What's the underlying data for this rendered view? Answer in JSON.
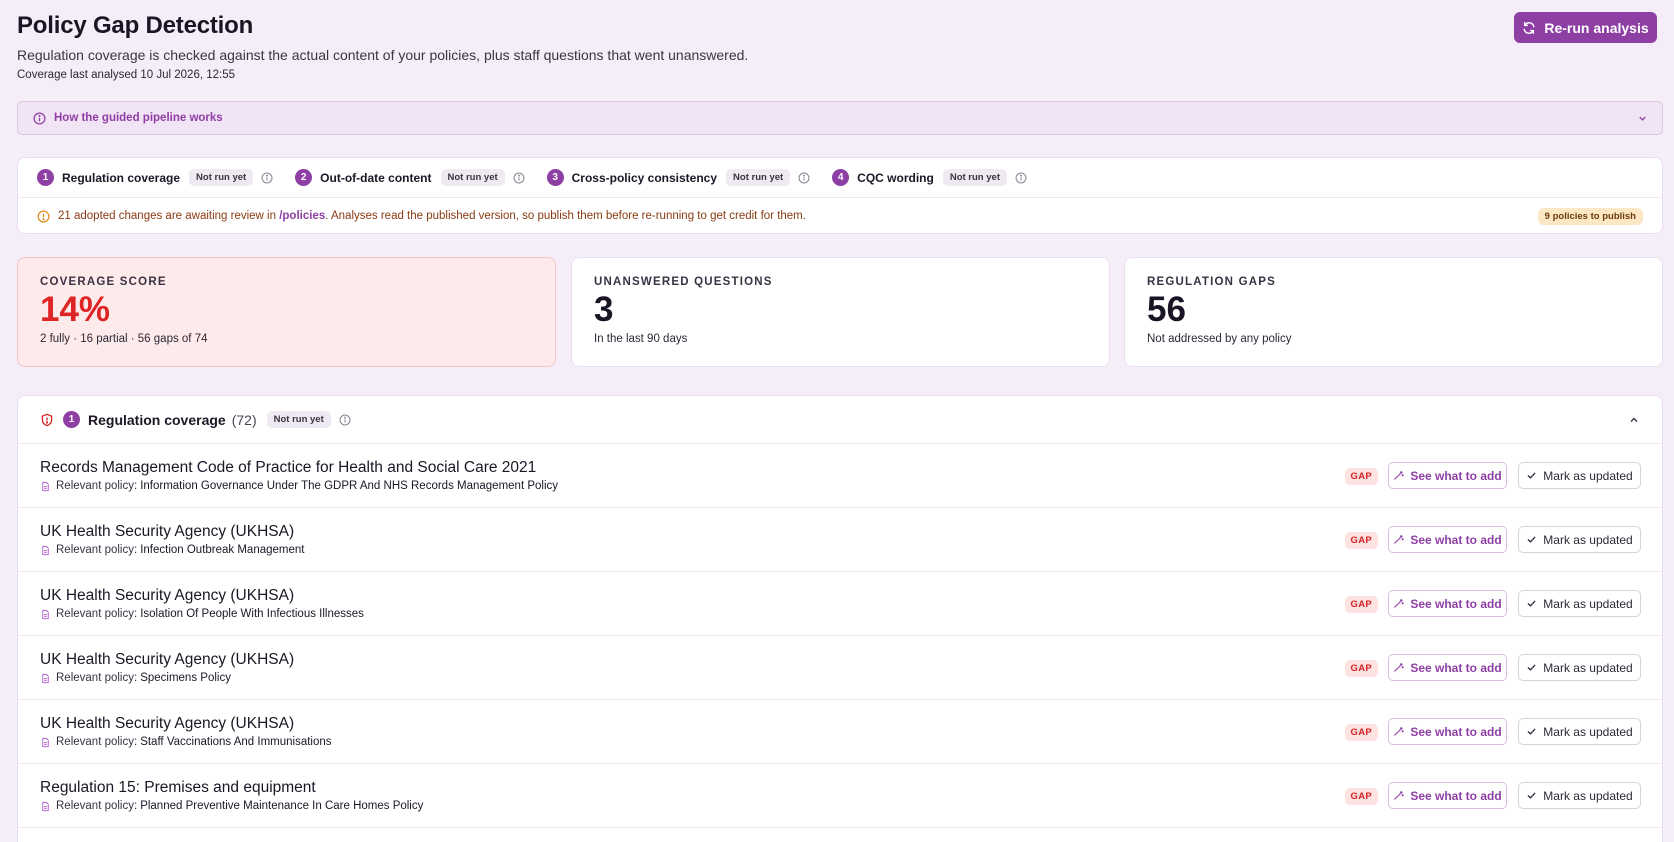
{
  "header": {
    "title": "Policy Gap Detection",
    "subtitle": "Regulation coverage is checked against the actual content of your policies, plus staff questions that went unanswered.",
    "last_analysed": "Coverage last analysed 10 Jul 2026, 12:55",
    "rerun_label": "Re-run analysis"
  },
  "pipeline": {
    "label": "How the guided pipeline works"
  },
  "steps": [
    {
      "num": "1",
      "label": "Regulation coverage",
      "status": "Not run yet"
    },
    {
      "num": "2",
      "label": "Out-of-date content",
      "status": "Not run yet"
    },
    {
      "num": "3",
      "label": "Cross-policy consistency",
      "status": "Not run yet"
    },
    {
      "num": "4",
      "label": "CQC wording",
      "status": "Not run yet"
    }
  ],
  "notice": {
    "text_before": "21 adopted changes are awaiting review in ",
    "link": "/policies",
    "text_after": ". Analyses read the published version, so publish them before re-running to get credit for them.",
    "badge": "9 policies to publish"
  },
  "stats": {
    "coverage": {
      "label": "COVERAGE SCORE",
      "value": "14%",
      "note": "2 fully · 16 partial · 56 gaps of 74"
    },
    "unanswered": {
      "label": "UNANSWERED QUESTIONS",
      "value": "3",
      "note": "In the last 90 days"
    },
    "gaps": {
      "label": "REGULATION GAPS",
      "value": "56",
      "note": "Not addressed by any policy"
    }
  },
  "section": {
    "num": "1",
    "title": "Regulation coverage",
    "count": "(72)",
    "status": "Not run yet"
  },
  "row_labels": {
    "relevant": "Relevant policy:",
    "gap": "GAP",
    "see": "See what to add",
    "mark": "Mark as updated"
  },
  "rows": [
    {
      "title": "Records Management Code of Practice for Health and Social Care 2021",
      "policy": "Information Governance Under The GDPR And NHS Records Management Policy"
    },
    {
      "title": "UK Health Security Agency (UKHSA)",
      "policy": "Infection Outbreak Management"
    },
    {
      "title": "UK Health Security Agency (UKHSA)",
      "policy": "Isolation Of People With Infectious Illnesses"
    },
    {
      "title": "UK Health Security Agency (UKHSA)",
      "policy": "Specimens Policy"
    },
    {
      "title": "UK Health Security Agency (UKHSA)",
      "policy": "Staff Vaccinations And Immunisations"
    },
    {
      "title": "Regulation 15: Premises and equipment",
      "policy": "Planned Preventive Maintenance In Care Homes Policy"
    }
  ],
  "colors": {
    "accent": "#8e3fa3",
    "danger": "#de2424",
    "background": "#f5eef9"
  }
}
